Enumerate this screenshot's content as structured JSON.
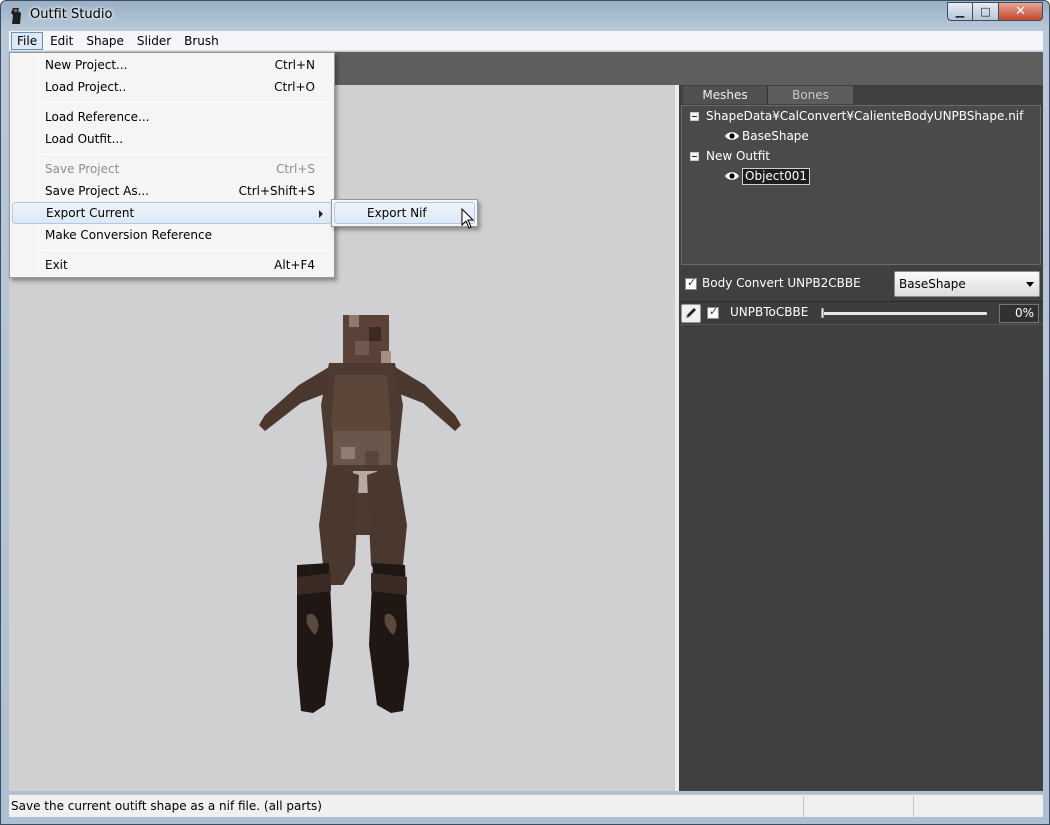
{
  "window": {
    "title": "Outfit Studio",
    "caption_buttons": {
      "minimize": "▁",
      "maximize": "□",
      "close": "✕"
    }
  },
  "menubar": {
    "items": [
      {
        "label": "File",
        "active": true
      },
      {
        "label": "Edit"
      },
      {
        "label": "Shape"
      },
      {
        "label": "Slider"
      },
      {
        "label": "Brush"
      }
    ]
  },
  "file_menu": {
    "items": [
      {
        "label": "New Project...",
        "shortcut": "Ctrl+N"
      },
      {
        "label": "Load Project..",
        "shortcut": "Ctrl+O"
      },
      {
        "label": "Load Reference...",
        "shortcut": ""
      },
      {
        "label": "Load Outfit...",
        "shortcut": ""
      },
      {
        "label": "Save Project",
        "shortcut": "Ctrl+S",
        "disabled": true
      },
      {
        "label": "Save Project As...",
        "shortcut": "Ctrl+Shift+S"
      },
      {
        "label": "Export Current",
        "shortcut": "",
        "submenu": true,
        "highlighted": true
      },
      {
        "label": "Make Conversion Reference",
        "shortcut": ""
      },
      {
        "label": "Exit",
        "shortcut": "Alt+F4"
      }
    ]
  },
  "export_submenu": {
    "items": [
      {
        "label": "Export Nif",
        "highlighted": true
      }
    ]
  },
  "panel": {
    "tabs": [
      {
        "label": "Meshes",
        "active": true
      },
      {
        "label": "Bones"
      }
    ],
    "tree": {
      "reference_group": "ShapeData¥CalConvert¥CalienteBodyUNPBShape.nif",
      "reference_child": "BaseShape",
      "outfit_group": "New Outfit",
      "outfit_child": "Object001"
    },
    "conversion": {
      "checked": true,
      "label": "Body Convert UNPB2CBBE",
      "dropdown_value": "BaseShape"
    },
    "slider": {
      "checked": true,
      "name": "UNPBToCBBE",
      "value": 0,
      "value_text": "0%"
    }
  },
  "statusbar": {
    "text": "Save the current outift shape as a nif file. (all parts)"
  },
  "colors": {
    "viewport_bg": "#d0d0d2",
    "panel_bg": "#404040",
    "toolbar_bg": "#5e5e5e",
    "menu_highlight": "#dce8f6"
  }
}
